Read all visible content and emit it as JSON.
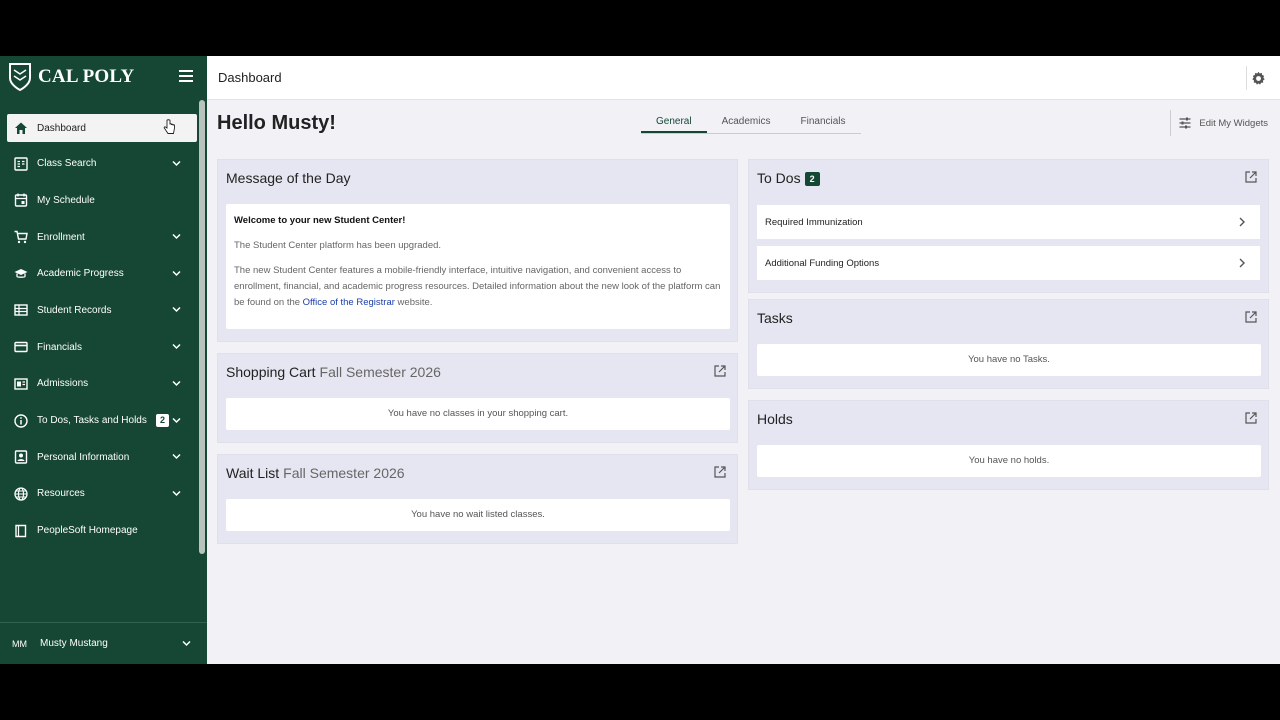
{
  "brand": {
    "name": "CAL POLY"
  },
  "sidebar": {
    "items": [
      {
        "label": "Dashboard",
        "icon": "home-icon",
        "active": true,
        "chevron": false
      },
      {
        "label": "Class Search",
        "icon": "class-search-icon",
        "chevron": true
      },
      {
        "label": "My Schedule",
        "icon": "calendar-icon",
        "chevron": false
      },
      {
        "label": "Enrollment",
        "icon": "cart-icon",
        "chevron": true
      },
      {
        "label": "Academic Progress",
        "icon": "graduation-cap-icon",
        "chevron": true
      },
      {
        "label": "Student Records",
        "icon": "records-icon",
        "chevron": true
      },
      {
        "label": "Financials",
        "icon": "credit-card-icon",
        "chevron": true
      },
      {
        "label": "Admissions",
        "icon": "admissions-icon",
        "chevron": true
      },
      {
        "label": "To Dos, Tasks and Holds",
        "icon": "info-icon",
        "chevron": true,
        "badge": "2"
      },
      {
        "label": "Personal Information",
        "icon": "contact-icon",
        "chevron": true
      },
      {
        "label": "Resources",
        "icon": "globe-icon",
        "chevron": true
      },
      {
        "label": "PeopleSoft Homepage",
        "icon": "book-icon",
        "chevron": false
      }
    ],
    "user": {
      "initials": "MM",
      "name": "Musty Mustang"
    }
  },
  "topbar": {
    "title": "Dashboard"
  },
  "main": {
    "greeting": "Hello Musty!",
    "tabs": [
      "General",
      "Academics",
      "Financials"
    ],
    "active_tab": "General",
    "edit_widgets_label": "Edit My Widgets"
  },
  "motd": {
    "title": "Message of the Day",
    "welcome": "Welcome to your new Student Center!",
    "line1": "The Student Center platform has been upgraded.",
    "line2_pre": "The new Student Center features a mobile-friendly interface, intuitive navigation, and convenient access to enrollment, financial, and academic progress resources. Detailed information about the new look of the platform can be found on the ",
    "line2_link": "Office of the Registrar",
    "line2_post": " website."
  },
  "shopping_cart": {
    "title": "Shopping Cart",
    "term": "Fall Semester 2026",
    "empty": "You have no classes in your shopping cart."
  },
  "wait_list": {
    "title": "Wait List",
    "term": "Fall Semester 2026",
    "empty": "You have no wait listed classes."
  },
  "todos": {
    "title": "To Dos",
    "count": "2",
    "items": [
      "Required Immunization",
      "Additional Funding Options"
    ]
  },
  "tasks": {
    "title": "Tasks",
    "empty": "You have no Tasks."
  },
  "holds": {
    "title": "Holds",
    "empty": "You have no holds."
  },
  "colors": {
    "brand_green": "#154734",
    "link_blue": "#1a3ea8"
  }
}
